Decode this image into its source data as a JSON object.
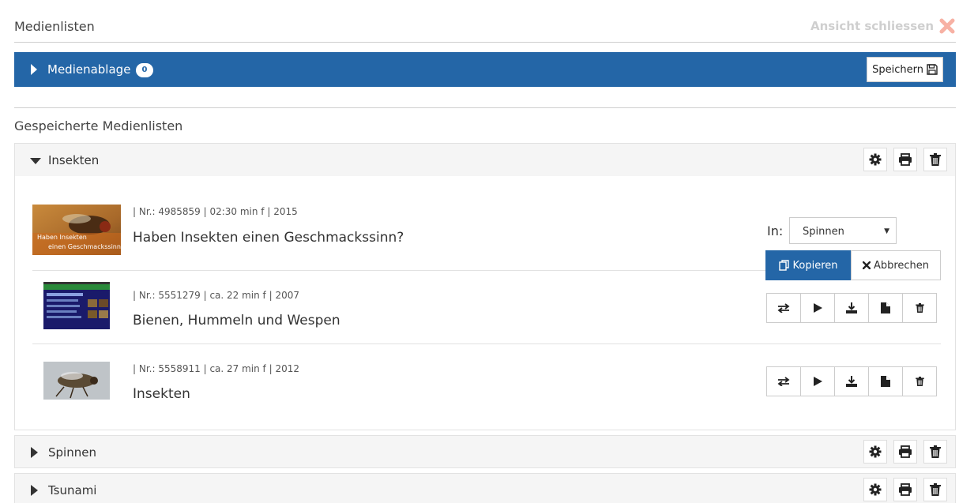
{
  "header": {
    "title": "Medienlisten",
    "close_label": "Ansicht schliessen"
  },
  "medienablage": {
    "label": "Medienablage",
    "count": "0",
    "save_label": "Speichern"
  },
  "saved": {
    "title": "Gespeicherte Medienlisten"
  },
  "lists": [
    {
      "name": "Insekten",
      "expanded": true,
      "items": [
        {
          "meta": "| Nr.: 4985859 | 02:30 min f | 2015",
          "title": "Haben Insekten einen Geschmackssinn?",
          "thumb_caption_1": "Haben Insekten",
          "thumb_caption_2": "einen Geschmackssinn ?"
        },
        {
          "meta": "| Nr.: 5551279 | ca. 22 min f | 2007",
          "title": "Bienen, Hummeln und Wespen"
        },
        {
          "meta": "| Nr.: 5558911 | ca. 27 min f | 2012",
          "title": "Insekten"
        }
      ]
    },
    {
      "name": "Spinnen",
      "expanded": false
    },
    {
      "name": "Tsunami",
      "expanded": false
    }
  ],
  "copy_form": {
    "in_label": "In:",
    "selected_option": "Spinnen",
    "copy_label": "Kopieren",
    "cancel_label": "Abbrechen"
  },
  "icons": {
    "close": "close-x-icon",
    "caret_right": "caret-right-icon",
    "caret_down": "caret-down-icon",
    "save": "floppy-disk-icon",
    "settings": "gear-icon",
    "print": "print-icon",
    "delete": "trash-icon",
    "copy": "copy-icon",
    "cancel": "times-icon",
    "swap": "exchange-icon",
    "play": "play-icon",
    "download": "download-icon",
    "file": "file-icon"
  },
  "colors": {
    "primary": "#2466a7",
    "close_icon": "#f7b1a4",
    "muted_text": "#cfcfcf",
    "panel_bg": "#f5f5f5"
  }
}
